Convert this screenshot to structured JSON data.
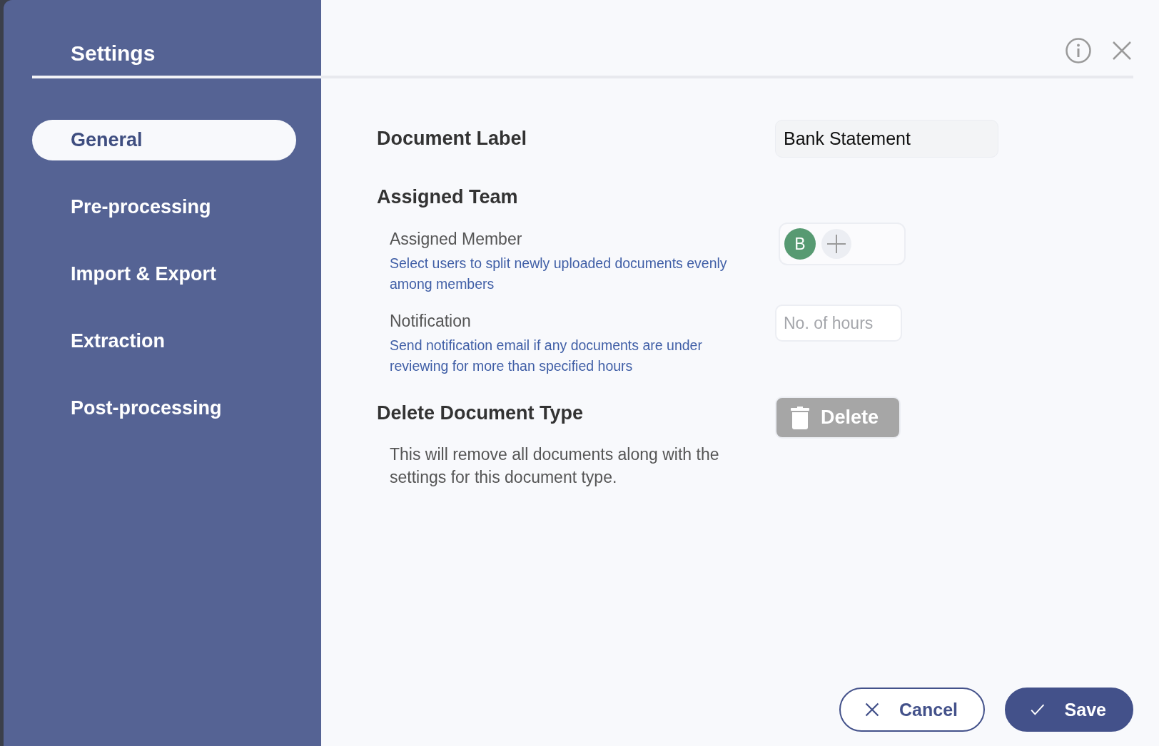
{
  "sidebar": {
    "title": "Settings",
    "items": [
      {
        "label": "General",
        "selected": true
      },
      {
        "label": "Pre-processing",
        "selected": false
      },
      {
        "label": "Import & Export",
        "selected": false
      },
      {
        "label": "Extraction",
        "selected": false
      },
      {
        "label": "Post-processing",
        "selected": false
      }
    ]
  },
  "form": {
    "document_label": {
      "label": "Document Label",
      "value": "Bank Statement"
    },
    "assigned_team": {
      "title": "Assigned Team",
      "member": {
        "label": "Assigned Member",
        "hint": "Select users to split newly uploaded documents evenly among members",
        "avatars": [
          {
            "initial": "B"
          }
        ]
      },
      "notification": {
        "label": "Notification",
        "hint": "Send notification email if any documents are under reviewing for more than specified hours",
        "placeholder": "No. of hours"
      }
    },
    "delete": {
      "title": "Delete Document Type",
      "button": "Delete",
      "disabled": true,
      "description": "This will remove all documents along with the settings for this document type."
    }
  },
  "footer": {
    "buttons": [
      {
        "label": "Cancel",
        "kind": "secondary"
      },
      {
        "label": "Save",
        "kind": "primary"
      }
    ]
  }
}
